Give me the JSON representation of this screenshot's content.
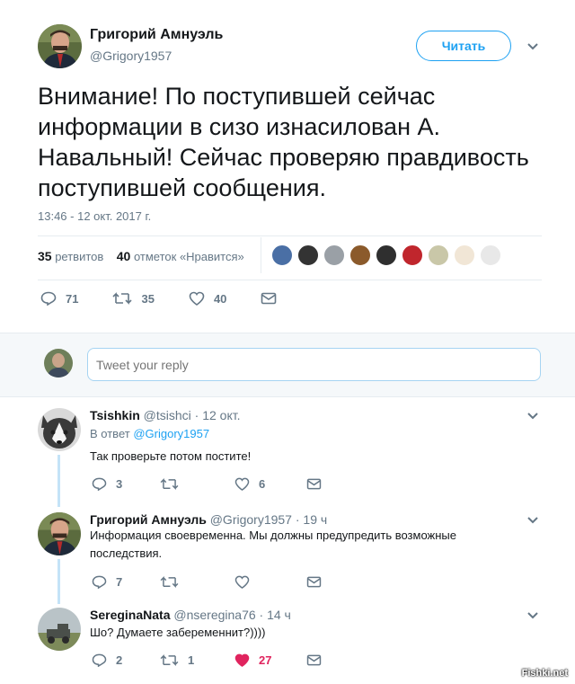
{
  "tweet": {
    "author_name": "Григорий Амнуэль",
    "author_handle": "@Grigory1957",
    "follow_label": "Читать",
    "text": "Внимание! По поступившей сейчас информации в сизо  изнасилован А. Навальный! Сейчас проверяю правдивость поступившей сообщения.",
    "timestamp": "13:46 - 12 окт. 2017 г.",
    "retweets_count": "35",
    "retweets_label": "ретвитов",
    "likes_count": "40",
    "likes_label": "отметок «Нравится»",
    "actions": {
      "replies": "71",
      "retweets": "35",
      "likes": "40"
    }
  },
  "reply_box": {
    "placeholder": "Tweet your reply"
  },
  "replies": [
    {
      "name": "Tsishkin",
      "handle": "@tsishci · 12 окт.",
      "in_reply_prefix": "В ответ",
      "in_reply_handle": "@Grigory1957",
      "text": "Так проверьте потом постите!",
      "replies": "3",
      "retweets": "",
      "likes": "6"
    },
    {
      "name": "Григорий Амнуэль",
      "handle": "@Grigory1957 · 19 ч",
      "text_line1": "Информация своевременна. Мы должны предупредить  возможные",
      "text_line2": "последствия.",
      "replies": "7",
      "retweets": "",
      "likes": ""
    },
    {
      "name": "SereginaNata",
      "handle": "@nseregina76 · 14 ч",
      "text": "Шо? Думаете забеременнит?))))",
      "replies": "2",
      "retweets": "1",
      "likes": "27"
    }
  ],
  "watermark": "Fishki.net",
  "colors": {
    "accent": "#1da1f2",
    "like_active": "#e0245e",
    "muted": "#657786"
  },
  "icons": [
    "reply-icon",
    "retweet-icon",
    "heart-icon",
    "envelope-icon",
    "chevron-down-icon"
  ]
}
